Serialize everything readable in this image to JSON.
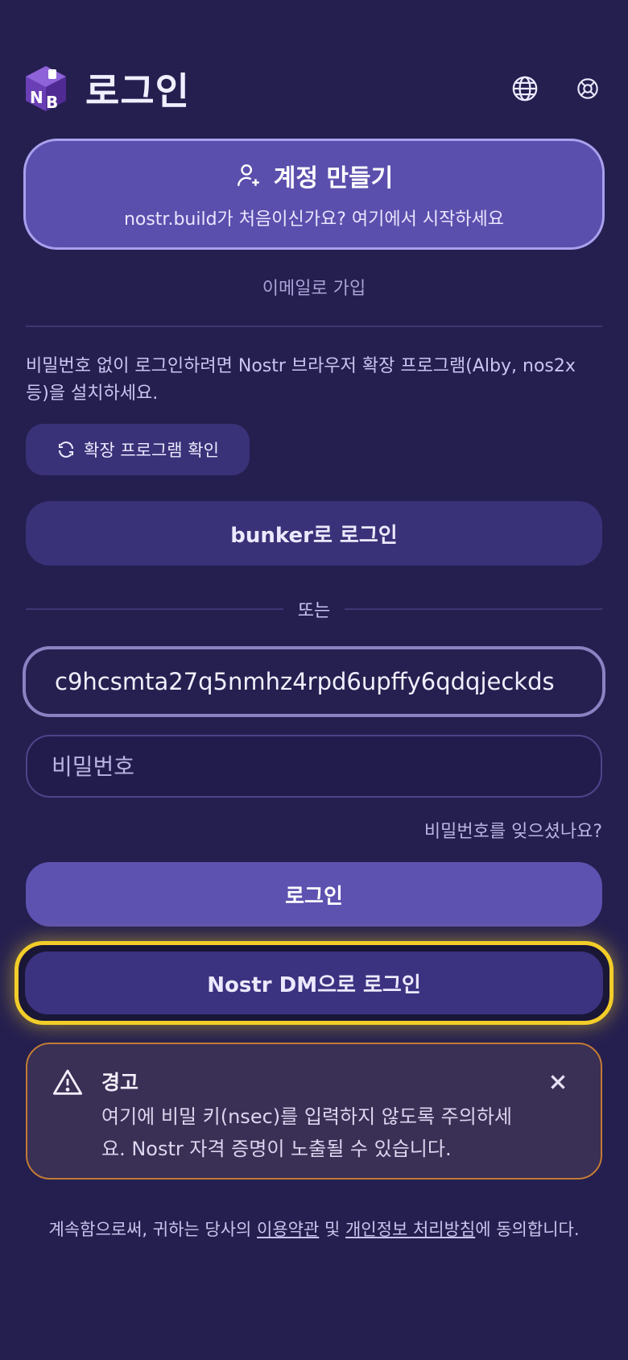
{
  "header": {
    "title": "로그인",
    "logo_text": "NB",
    "icons": [
      "globe-icon",
      "lifebuoy-icon"
    ]
  },
  "create_account": {
    "title": "계정 만들기",
    "subtitle": "nostr.build가 처음이신가요? 여기에서 시작하세요"
  },
  "email_signup": "이메일로 가입",
  "extension_note": "비밀번호 없이 로그인하려면 Nostr 브라우저 확장 프로그램(Alby, nos2x 등)을 설치하세요.",
  "check_extension_button": "확장 프로그램 확인",
  "bunker_button": "bunker로 로그인",
  "or_divider": "또는",
  "npub_input": {
    "value": "c9hcsmta27q5nmhz4rpd6upffy6qdqjeckds"
  },
  "password_input": {
    "placeholder": "비밀번호"
  },
  "forgot_password": "비밀번호를 잊으셨나요?",
  "login_button": "로그인",
  "nostr_dm_button": "Nostr DM으로 로그인",
  "warning": {
    "title": "경고",
    "text": "여기에 비밀 키(nsec)를 입력하지 않도록 주의하세요. Nostr 자격 증명이 노출될 수 있습니다."
  },
  "terms": {
    "prefix": "계속함으로써, 귀하는 당사의 ",
    "terms_link": "이용약관",
    "middle": " 및 ",
    "privacy_link": "개인정보 처리방침",
    "suffix": "에 동의합니다."
  },
  "colors": {
    "background": "#241f4f",
    "primary": "#5b4fad",
    "secondary_button": "#3a3278",
    "highlight": "#f2cd2a",
    "warning_border": "#c27b34"
  }
}
